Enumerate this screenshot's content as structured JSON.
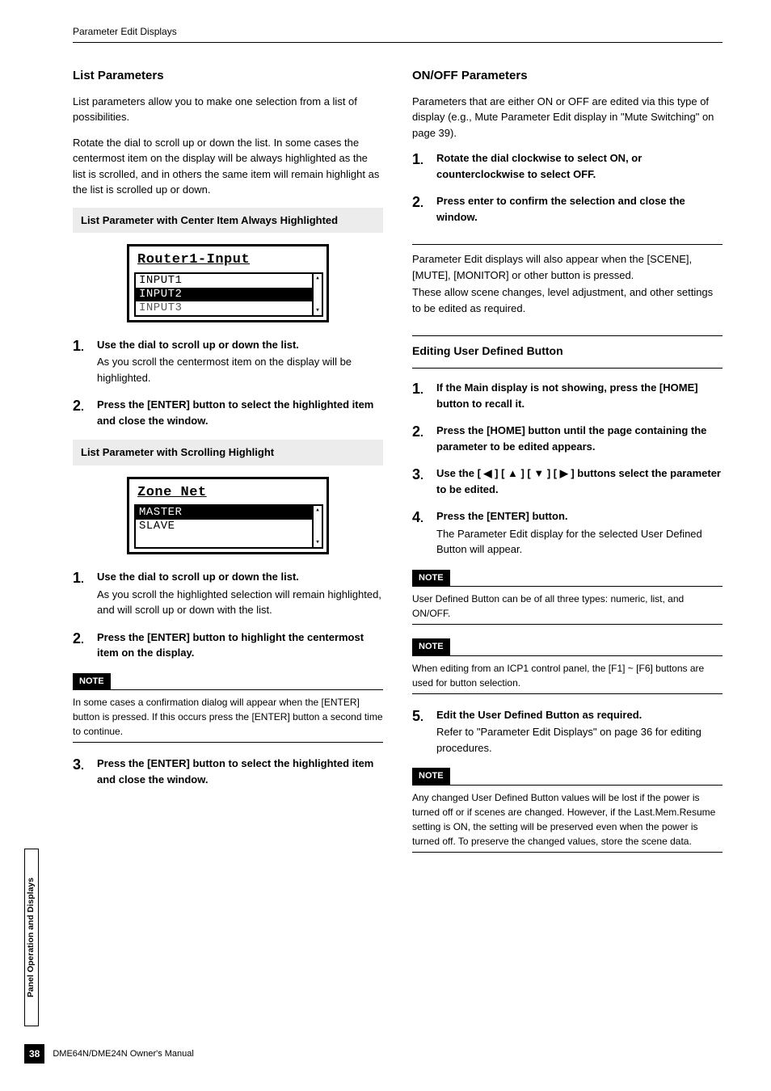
{
  "running_head": "Parameter Edit Displays",
  "side_tab": "Panel Operation and Displays",
  "page_number": "38",
  "footer_text": "DME64N/DME24N Owner's Manual",
  "left": {
    "h2": "List Parameters",
    "intro1": "List parameters allow you to make one selection from a list of possibilities.",
    "intro2": "Rotate the dial to scroll up or down the list. In some cases the centermost item on the display will be always highlighted as the list is scrolled, and in others the same item will remain highlight as the list is scrolled up or down.",
    "box1_title": "List Parameter with Center Item Always Highlighted",
    "lcd1": {
      "title": "Router1-Input",
      "rows": [
        "INPUT1",
        "INPUT2",
        "INPUT3"
      ],
      "selected_index": 1
    },
    "steps1": [
      {
        "lead": "Use the dial to scroll up or down the list.",
        "sub": "As you scroll the centermost item on the display will be highlighted."
      },
      {
        "lead": "Press the [ENTER] button to select the highlighted item and close the window."
      }
    ],
    "box2_title": "List Parameter with Scrolling Highlight",
    "lcd2": {
      "title": "Zone Net",
      "rows": [
        "MASTER",
        "SLAVE"
      ],
      "selected_index": 0
    },
    "steps2": [
      {
        "lead": "Use the dial to scroll up or down the list.",
        "sub": "As you scroll the highlighted selection will remain highlighted, and will scroll up or down with the list."
      },
      {
        "lead": "Press the [ENTER] button to highlight the centermost item on the display."
      }
    ],
    "note_label": "NOTE",
    "note1_body": "In some cases a confirmation dialog will appear when the [ENTER] button is pressed. If this occurs press the [ENTER] button a second time to continue.",
    "steps3": [
      {
        "lead": "Press the [ENTER] button to select the highlighted item and close the window."
      }
    ]
  },
  "right": {
    "h2": "ON/OFF Parameters",
    "intro": "Parameters that are either ON or OFF are edited via this type of display (e.g., Mute Parameter Edit display in \"Mute Switching\" on page 39).",
    "steps1": [
      {
        "lead": "Rotate the dial clockwise to select ON, or counterclockwise to select OFF."
      },
      {
        "lead": "Press enter to confirm the selection and close the window."
      }
    ],
    "mid1": "Parameter Edit displays will also appear when the [SCENE], [MUTE], [MONITOR] or other button is pressed.",
    "mid2": "These allow scene changes, level adjustment, and other settings to be edited as required.",
    "h3": "Editing User Defined Button",
    "steps2": [
      {
        "lead": "If the Main display is not showing, press the [HOME] button to recall it."
      },
      {
        "lead": "Press the [HOME] button until the page containing the parameter to be edited appears."
      },
      {
        "lead": "Use the [ ◀ ] [ ▲ ] [ ▼ ] [ ▶ ] buttons select the parameter to be edited."
      },
      {
        "lead": "Press the [ENTER] button.",
        "sub": "The Parameter Edit display for the selected User Defined Button will appear."
      }
    ],
    "note_label": "NOTE",
    "note1_body": "User Defined Button can be of all three types: numeric, list, and ON/OFF.",
    "note2_body": "When editing from an ICP1 control panel, the [F1] ~ [F6] buttons are used for button selection.",
    "steps3": [
      {
        "lead": "Edit the User Defined Button as required.",
        "sub": "Refer to \"Parameter Edit Displays\" on page 36 for editing procedures."
      }
    ],
    "note3_body": "Any changed User Defined Button values will be lost if the power is turned off or if scenes are changed. However, if the Last.Mem.Resume setting is ON, the setting will be preserved even when the power is turned off. To preserve the changed values, store the scene data."
  }
}
